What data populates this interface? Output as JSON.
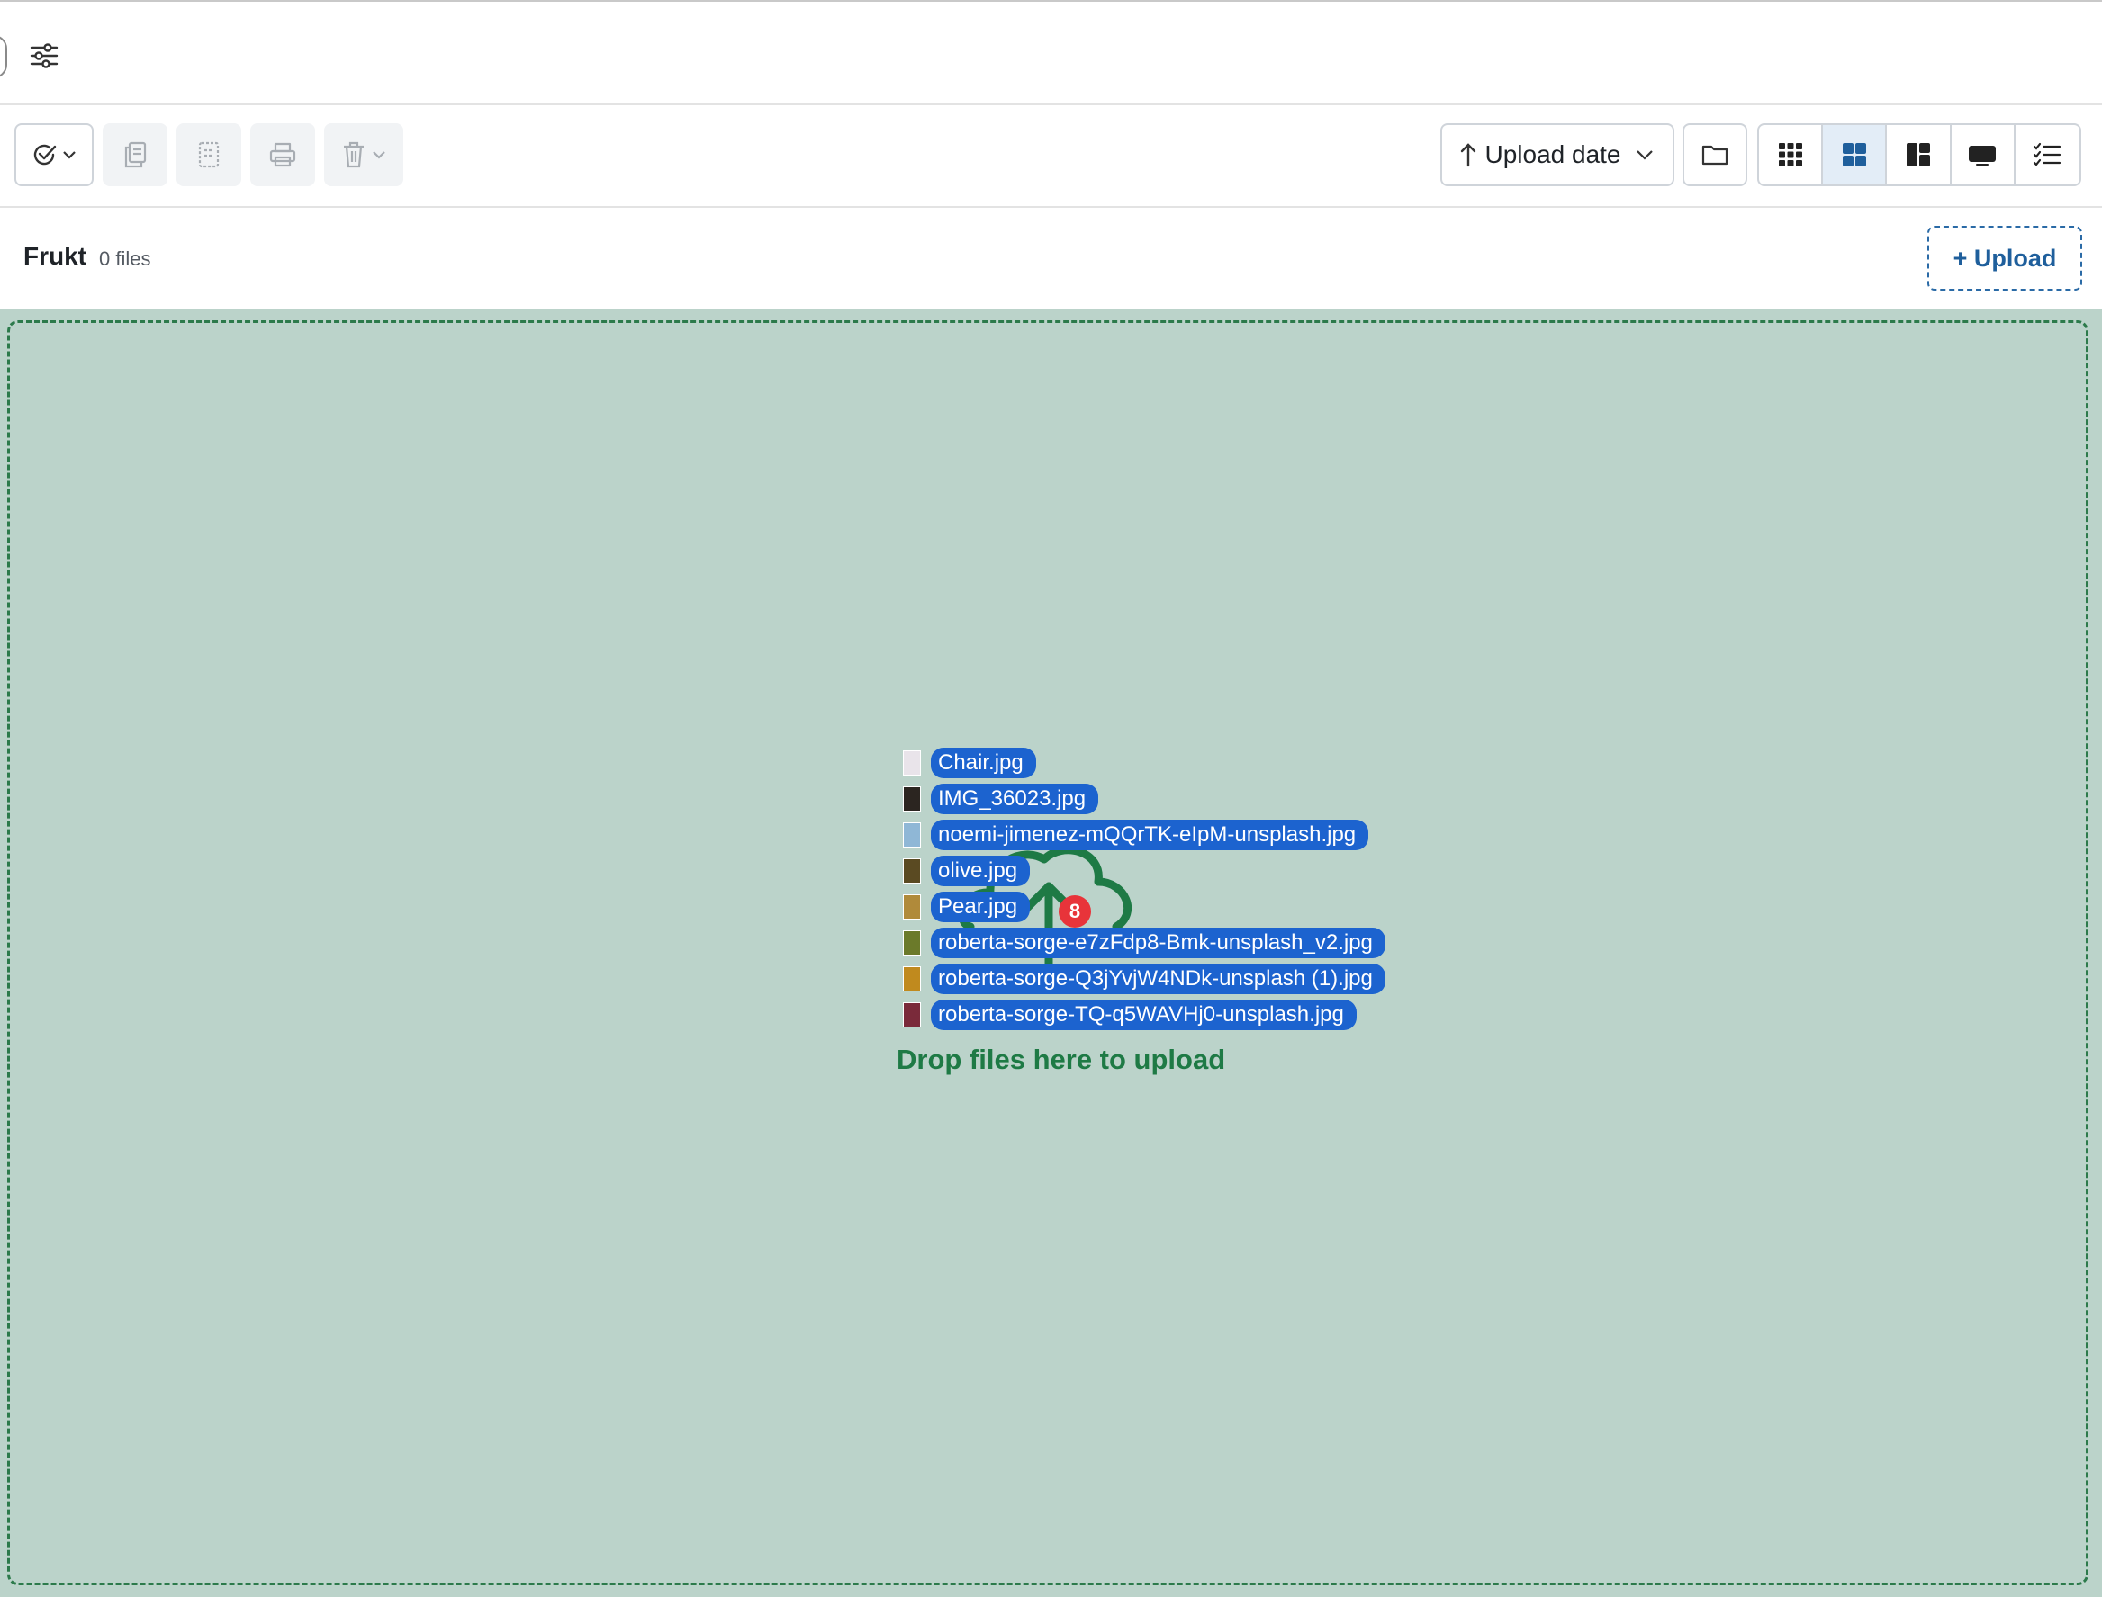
{
  "toolbar": {
    "sort_label": "Upload date",
    "sort_direction_icon": "arrow-up-icon",
    "view_modes": [
      {
        "name": "view-small-grid-button",
        "icon": "small-grid-icon",
        "active": false
      },
      {
        "name": "view-grid-button",
        "icon": "grid-icon",
        "active": true
      },
      {
        "name": "view-masonry-button",
        "icon": "masonry-icon",
        "active": false
      },
      {
        "name": "view-single-button",
        "icon": "single-view-icon",
        "active": false
      },
      {
        "name": "view-list-button",
        "icon": "list-icon",
        "active": false
      }
    ]
  },
  "folder": {
    "name": "Frukt",
    "file_count": "0 files",
    "upload_label": "+ Upload"
  },
  "dropzone": {
    "message": "Drop files here to upload",
    "badge_count": "8",
    "files": [
      {
        "name": "Chair.jpg",
        "thumb_color": "#e9e4ea"
      },
      {
        "name": "IMG_36023.jpg",
        "thumb_color": "#2b2520"
      },
      {
        "name": "noemi-jimenez-mQQrTK-eIpM-unsplash.jpg",
        "thumb_color": "#8fb7d6"
      },
      {
        "name": "olive.jpg",
        "thumb_color": "#5a4a22"
      },
      {
        "name": "Pear.jpg",
        "thumb_color": "#b08a3a"
      },
      {
        "name": "roberta-sorge-e7zFdp8-Bmk-unsplash_v2.jpg",
        "thumb_color": "#6b7a2a"
      },
      {
        "name": "roberta-sorge-Q3jYvjW4NDk-unsplash (1).jpg",
        "thumb_color": "#c08a1e"
      },
      {
        "name": "roberta-sorge-TQ-q5WAVHj0-unsplash.jpg",
        "thumb_color": "#7a2a3a"
      }
    ]
  },
  "colors": {
    "accent": "#1c63cf",
    "drop_green": "#1e7a45",
    "drop_bg": "#bbd3ca",
    "badge": "#e8343a"
  }
}
